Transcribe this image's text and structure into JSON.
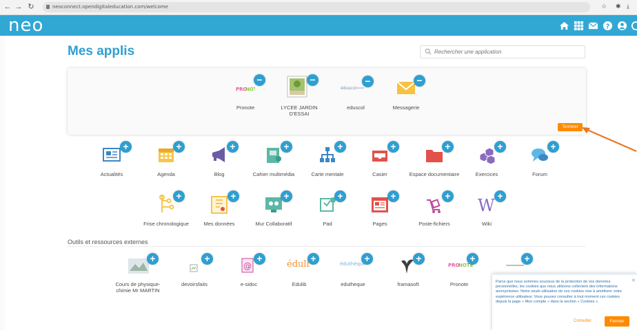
{
  "browser": {
    "url": "neoconnect.opendigitaleducation.com/welcome"
  },
  "header": {
    "logo": "neo",
    "icons": [
      "home-icon",
      "apps-grid-icon",
      "mail-icon",
      "help-icon",
      "user-icon"
    ]
  },
  "page": {
    "title": "Mes applis",
    "search_placeholder": "Rechercher une application",
    "finish_label": "Terminer"
  },
  "favorites": [
    {
      "label": "Pronote",
      "icon": "pronote-logo",
      "badge": "−"
    },
    {
      "label": "LYCEE JARDIN D'ESSAI",
      "icon": "school-image",
      "badge": "−"
    },
    {
      "label": "eduscol",
      "icon": "eduscol-logo",
      "badge": "−"
    },
    {
      "label": "Messagerie",
      "icon": "mail-icon",
      "badge": "−"
    }
  ],
  "apps": [
    {
      "label": "Actualités",
      "icon": "newspaper-icon",
      "badge": "+"
    },
    {
      "label": "Agenda",
      "icon": "calendar-icon",
      "badge": "+"
    },
    {
      "label": "Blog",
      "icon": "megaphone-icon",
      "badge": "+"
    },
    {
      "label": "Cahier multimédia",
      "icon": "notebook-icon",
      "badge": "+"
    },
    {
      "label": "Carte mentale",
      "icon": "mindmap-icon",
      "badge": "+"
    },
    {
      "label": "Casier",
      "icon": "inbox-icon",
      "badge": "+"
    },
    {
      "label": "Espace documentaire",
      "icon": "folder-icon",
      "badge": "+"
    },
    {
      "label": "Exercices",
      "icon": "cubes-icon",
      "badge": "+"
    },
    {
      "label": "Forum",
      "icon": "chat-icon",
      "badge": "+"
    },
    {
      "label": "Frise chronologique",
      "icon": "timeline-icon",
      "badge": "+"
    },
    {
      "label": "Mes données",
      "icon": "data-icon",
      "badge": "+"
    },
    {
      "label": "Mur Collaboratif",
      "icon": "wall-icon",
      "badge": "+"
    },
    {
      "label": "Pad",
      "icon": "pad-icon",
      "badge": "+"
    },
    {
      "label": "Pages",
      "icon": "pages-icon",
      "badge": "+"
    },
    {
      "label": "Poste-fichiers",
      "icon": "cart-icon",
      "badge": "+"
    },
    {
      "label": "Wiki",
      "icon": "wiki-icon",
      "badge": "+"
    }
  ],
  "external": {
    "title": "Outils et ressources externes",
    "items": [
      {
        "label": "Cours de physique-chimie Mr MARTIN",
        "icon": "course-image",
        "badge": "+"
      },
      {
        "label": "devoirsfaits",
        "icon": "broken-image-icon",
        "badge": "+"
      },
      {
        "label": "e-sidoc",
        "icon": "esidoc-logo",
        "badge": "+"
      },
      {
        "label": "Edulib",
        "icon": "edulib-logo",
        "badge": "+"
      },
      {
        "label": "edutheque",
        "icon": "edutheque-logo",
        "badge": "+"
      },
      {
        "label": "framasoft",
        "icon": "framasoft-logo",
        "badge": "+"
      },
      {
        "label": "Pronote",
        "icon": "pronote-logo",
        "badge": "+"
      },
      {
        "label": "",
        "icon": "generic-logo",
        "badge": "+"
      }
    ]
  },
  "cookie": {
    "text": "Parce que nous sommes soucieux de la protection de vos données personnelles, les cookies que nous utilisons collectent des informations anonymisées. Notre seule utilisation de ces cookies vise à améliorer votre expérience utilisateur. Vous pouvez consulter à tout moment ces cookies depuis la page « Mon compte » dans la section « Cookies ».",
    "consult_label": "Consulter",
    "close_label": "Fermer"
  },
  "colors": {
    "brand": "#31a7d4",
    "accent": "#ff8a00",
    "badge": "#2e9fd0"
  }
}
